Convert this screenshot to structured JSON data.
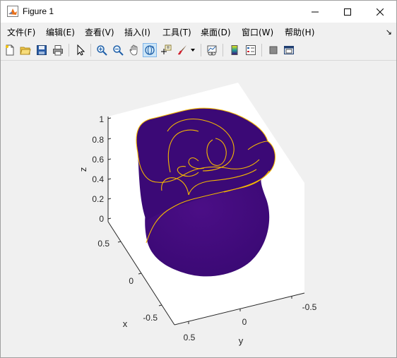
{
  "window": {
    "title": "Figure 1",
    "controls": [
      "minimize",
      "maximize",
      "close"
    ]
  },
  "menubar": {
    "items": [
      {
        "label": "文件(F)"
      },
      {
        "label": "编辑(E)"
      },
      {
        "label": "查看(V)"
      },
      {
        "label": "插入(I)"
      },
      {
        "label": "工具(T)"
      },
      {
        "label": "桌面(D)"
      },
      {
        "label": "窗口(W)"
      },
      {
        "label": "帮助(H)"
      }
    ],
    "corner_icon": "↘"
  },
  "toolbar": {
    "buttons": [
      "new-figure-icon",
      "open-file-icon",
      "save-icon",
      "print-icon",
      "edit-plot-icon",
      "zoom-in-icon",
      "zoom-out-icon",
      "pan-icon",
      "rotate-3d-icon",
      "data-cursor-icon",
      "brush-icon",
      "link-plot-icon",
      "insert-colorbar-icon",
      "insert-legend-icon",
      "hide-plot-tools-icon",
      "show-plot-tools-icon"
    ],
    "active": "rotate-3d-icon"
  },
  "plot": {
    "z_axis": {
      "label": "z",
      "ticks": [
        "1",
        "0.8",
        "0.6",
        "0.4",
        "0.2",
        "0"
      ]
    },
    "x_axis": {
      "label": "x",
      "ticks": [
        "0.5",
        "0",
        "-0.5"
      ]
    },
    "y_axis": {
      "label": "y",
      "ticks": [
        "0.5",
        "0",
        "-0.5"
      ]
    },
    "surface_color": "#3d0a78",
    "edge_color": "#f5b800",
    "view": "3d-rotate"
  }
}
